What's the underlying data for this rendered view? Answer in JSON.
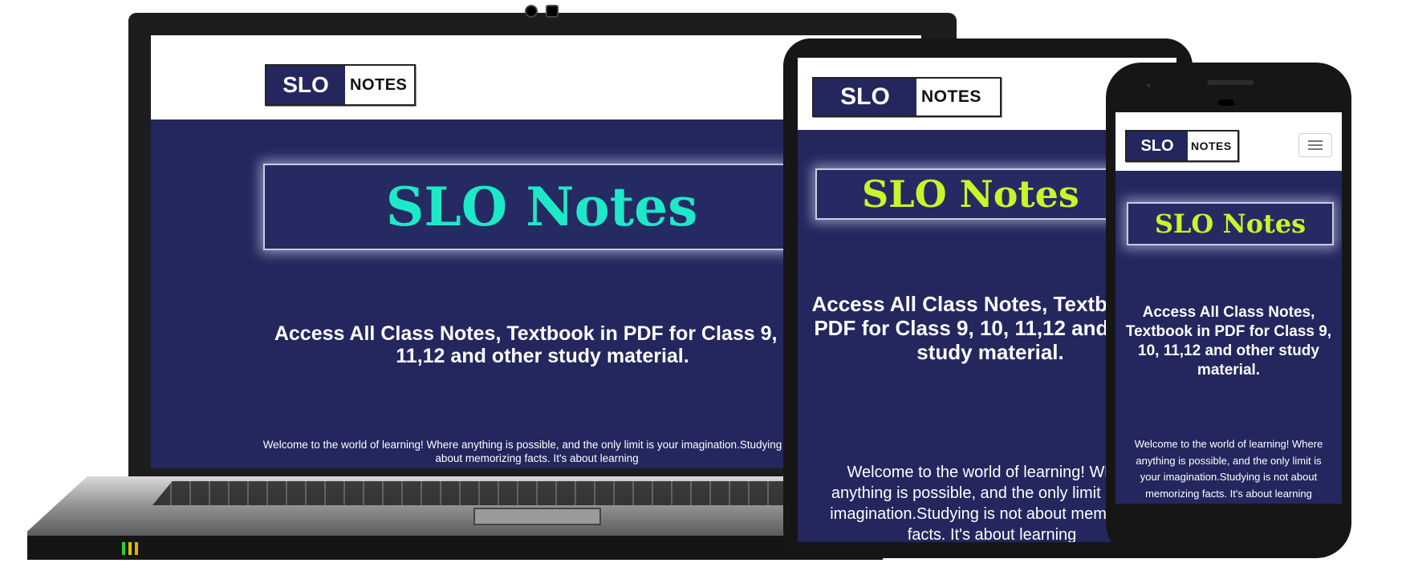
{
  "brand": {
    "logo_slo": "SLO",
    "logo_notes": "NOTES"
  },
  "hero": {
    "title": "SLO Notes"
  },
  "tagline": "Access All Class Notes, Textbook in PDF for Class 9, 10, 11,12 and other study material.",
  "welcome": "Welcome to the world of learning! Where anything is possible, and the only limit is your imagination.Studying is not about memorizing facts. It's about learning",
  "colors": {
    "site_background": "#23275e",
    "header_background": "#ffffff",
    "title_laptop": "#1de9c8",
    "title_mobile": "#c8f52a",
    "text": "#ffffff"
  },
  "icons": {
    "menu": "hamburger-icon"
  }
}
